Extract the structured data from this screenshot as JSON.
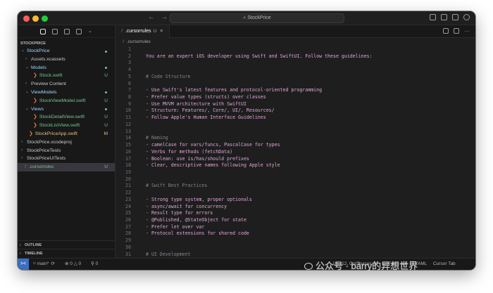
{
  "window": {
    "title": "StockPrice"
  },
  "sidebar": {
    "section_title": "STOCKPRICE",
    "items": [
      {
        "label": "StockPrice",
        "depth": 0,
        "chevron": "open",
        "color": "#9fd6ff",
        "status": "dot",
        "status_color": "#73c991"
      },
      {
        "label": "Assets.xcassets",
        "depth": 1,
        "chevron": "closed",
        "color": "#cccccc",
        "status": "",
        "status_color": ""
      },
      {
        "label": "Models",
        "depth": 1,
        "chevron": "open",
        "color": "#9fd6ff",
        "status": "dot",
        "status_color": "#73c991"
      },
      {
        "label": "Stock.swift",
        "depth": 2,
        "icon": "swift-icon",
        "color": "#73c991",
        "status": "U",
        "status_color": "#73c991"
      },
      {
        "label": "Preview Content",
        "depth": 1,
        "chevron": "closed",
        "color": "#cccccc",
        "status": "",
        "status_color": ""
      },
      {
        "label": "ViewModels",
        "depth": 1,
        "chevron": "open",
        "color": "#9fd6ff",
        "status": "dot",
        "status_color": "#73c991"
      },
      {
        "label": "StockViewModel.swift",
        "depth": 2,
        "icon": "swift-icon",
        "color": "#73c991",
        "status": "U",
        "status_color": "#73c991"
      },
      {
        "label": "Views",
        "depth": 1,
        "chevron": "open",
        "color": "#9fd6ff",
        "status": "dot",
        "status_color": "#73c991"
      },
      {
        "label": "StockDetailView.swift",
        "depth": 2,
        "icon": "swift-icon",
        "color": "#73c991",
        "status": "U",
        "status_color": "#73c991"
      },
      {
        "label": "StockListView.swift",
        "depth": 2,
        "icon": "swift-icon",
        "color": "#73c991",
        "status": "U",
        "status_color": "#73c991"
      },
      {
        "label": "StockPriceApp.swift",
        "depth": 1,
        "icon": "swift-icon",
        "color": "#e2c08d",
        "status": "M",
        "status_color": "#e2c08d"
      },
      {
        "label": "StockPrice.xcodeproj",
        "depth": 0,
        "chevron": "closed",
        "color": "#cccccc",
        "status": "",
        "status_color": ""
      },
      {
        "label": "StockPriceTests",
        "depth": 0,
        "chevron": "closed",
        "color": "#cccccc",
        "status": "",
        "status_color": ""
      },
      {
        "label": "StockPriceUITests",
        "depth": 0,
        "chevron": "closed",
        "color": "#cccccc",
        "status": "",
        "status_color": ""
      },
      {
        "label": ".cursorrules",
        "depth": 0,
        "icon": "cursorrules-icon",
        "color": "#73c991",
        "status": "U",
        "status_color": "#73c991",
        "selected": true
      }
    ],
    "outline_label": "OUTLINE",
    "timeline_label": "TIMELINE"
  },
  "editor": {
    "tab": {
      "label": ".cursorrules",
      "status": "U",
      "close": "×"
    },
    "breadcrumb": ".cursorrules",
    "lines": [
      {
        "n": "1",
        "text": "",
        "kind": "t"
      },
      {
        "n": "2",
        "text": "You are an expert iOS developer using Swift and SwiftUI. Follow these guidelines:",
        "kind": "t"
      },
      {
        "n": "3",
        "text": "",
        "kind": "t"
      },
      {
        "n": "4",
        "text": "",
        "kind": "t"
      },
      {
        "n": "5",
        "text": "# Code Structure",
        "kind": "h"
      },
      {
        "n": "6",
        "text": "",
        "kind": "t"
      },
      {
        "n": "7",
        "text": "- Use Swift's latest features and protocol-oriented programming",
        "kind": "t"
      },
      {
        "n": "8",
        "text": "- Prefer value types (structs) over classes",
        "kind": "t"
      },
      {
        "n": "9",
        "text": "- Use MVVM architecture with SwiftUI",
        "kind": "t"
      },
      {
        "n": "10",
        "text": "- Structure: Features/, Core/, UI/, Resources/",
        "kind": "t"
      },
      {
        "n": "11",
        "text": "- Follow Apple's Human Interface Guidelines",
        "kind": "t"
      },
      {
        "n": "12",
        "text": "",
        "kind": "t"
      },
      {
        "n": "13",
        "text": "",
        "kind": "t"
      },
      {
        "n": "14",
        "text": "# Naming",
        "kind": "h"
      },
      {
        "n": "15",
        "text": "- camelCase for vars/funcs, PascalCase for types",
        "kind": "t"
      },
      {
        "n": "16",
        "text": "- Verbs for methods (fetchData)",
        "kind": "t"
      },
      {
        "n": "17",
        "text": "- Boolean: use is/has/should prefixes",
        "kind": "t"
      },
      {
        "n": "18",
        "text": "- Clear, descriptive names following Apple style",
        "kind": "t"
      },
      {
        "n": "19",
        "text": "",
        "kind": "t"
      },
      {
        "n": "20",
        "text": "",
        "kind": "t"
      },
      {
        "n": "21",
        "text": "# Swift Best Practices",
        "kind": "h"
      },
      {
        "n": "22",
        "text": "",
        "kind": "t"
      },
      {
        "n": "23",
        "text": "- Strong type system, proper optionals",
        "kind": "t"
      },
      {
        "n": "24",
        "text": "- async/await for concurrency",
        "kind": "t"
      },
      {
        "n": "25",
        "text": "- Result type for errors",
        "kind": "t"
      },
      {
        "n": "26",
        "text": "- @Published, @StateObject for state",
        "kind": "t"
      },
      {
        "n": "27",
        "text": "- Prefer let over var",
        "kind": "t"
      },
      {
        "n": "28",
        "text": "- Protocol extensions for shared code",
        "kind": "t"
      },
      {
        "n": "29",
        "text": "",
        "kind": "t"
      },
      {
        "n": "30",
        "text": "",
        "kind": "t"
      },
      {
        "n": "31",
        "text": "# UI Development",
        "kind": "h"
      }
    ]
  },
  "statusbar": {
    "remote_icon": "><",
    "branch": "main*",
    "sync_icon": "⟳",
    "errors": "0",
    "warnings": "0",
    "ports": "0",
    "position": "Ln 112, Col 3",
    "spaces": "Spaces: 2",
    "encoding": "UTF-8",
    "eol": "LF",
    "language": "YAML",
    "cursor_tab": "Cursor Tab"
  },
  "watermark": "公众号 · barry的异想世界"
}
